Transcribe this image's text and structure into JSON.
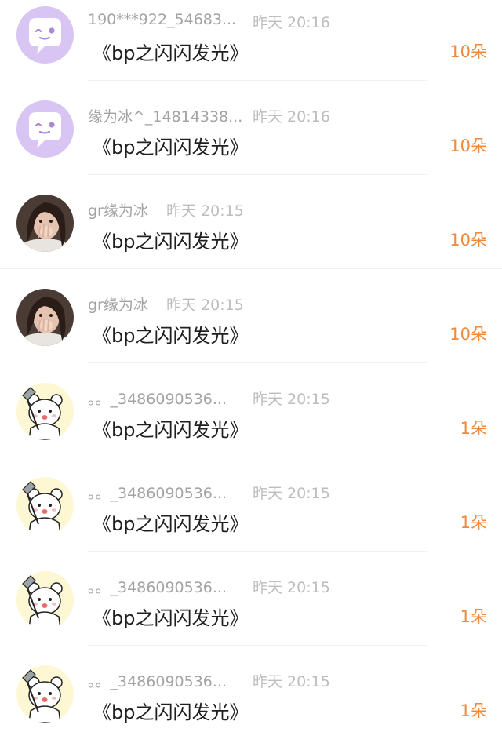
{
  "colors": {
    "username": "#a3a3a3",
    "time": "#bdbdbd",
    "gift_name": "#1f1f1f",
    "count": "#ee8a3d",
    "avatar_purple": "#d8c5f3"
  },
  "items": [
    {
      "avatar": "purple-chat-face-icon",
      "username": "190***922_54683...",
      "time": "昨天 20:16",
      "gift": "《bp之闪闪发光》",
      "count": "10朵"
    },
    {
      "avatar": "purple-chat-face-icon",
      "username": "缘为冰^_14814338...",
      "time": "昨天 20:16",
      "gift": "《bp之闪闪发光》",
      "count": "10朵"
    },
    {
      "avatar": "girl-photo-avatar",
      "username": "gr缘为冰",
      "time": "昨天 20:15",
      "gift": "《bp之闪闪发光》",
      "count": "10朵"
    },
    {
      "avatar": "girl-photo-avatar",
      "username": "gr缘为冰",
      "time": "昨天 20:15",
      "gift": "《bp之闪闪发光》",
      "count": "10朵"
    },
    {
      "avatar": "bear-cartoon-avatar",
      "username": "。。_3486090536...",
      "time": "昨天 20:15",
      "gift": "《bp之闪闪发光》",
      "count": "1朵"
    },
    {
      "avatar": "bear-cartoon-avatar",
      "username": "。。_3486090536...",
      "time": "昨天 20:15",
      "gift": "《bp之闪闪发光》",
      "count": "1朵"
    },
    {
      "avatar": "bear-cartoon-avatar",
      "username": "。。_3486090536...",
      "time": "昨天 20:15",
      "gift": "《bp之闪闪发光》",
      "count": "1朵"
    },
    {
      "avatar": "bear-cartoon-avatar",
      "username": "。。_3486090536...",
      "time": "昨天 20:15",
      "gift": "《bp之闪闪发光》",
      "count": "1朵"
    }
  ]
}
